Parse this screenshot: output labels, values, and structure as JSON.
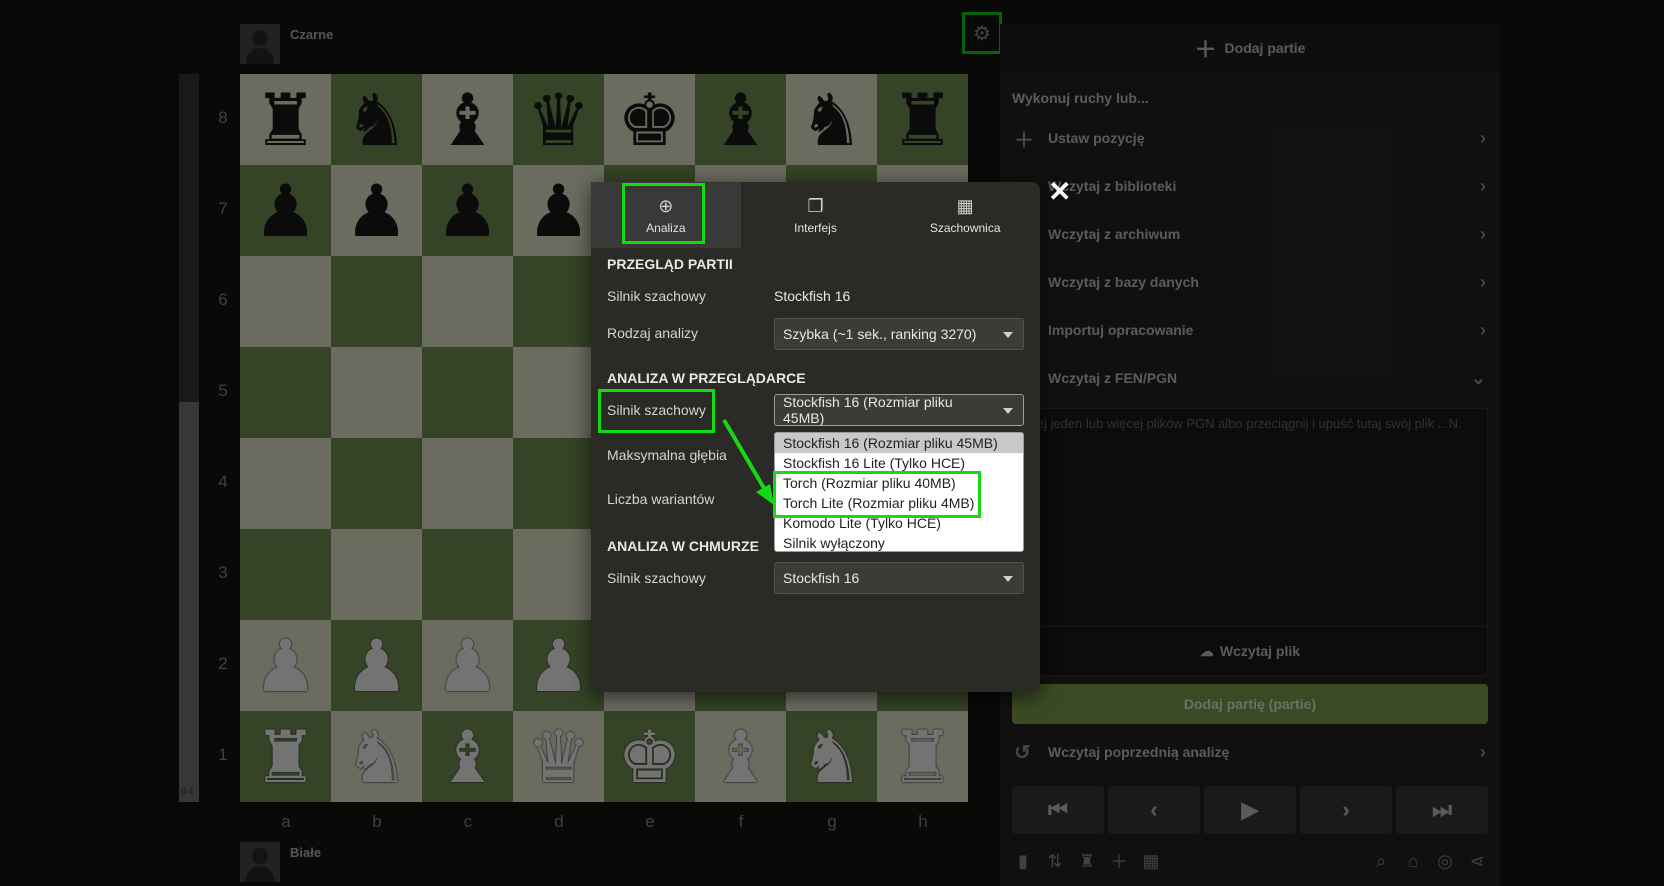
{
  "players": {
    "top_name": "Czarne",
    "bottom_name": "Białe"
  },
  "eval": {
    "label": "0.4",
    "white_fraction": 0.55
  },
  "board": {
    "ranks": [
      "8",
      "7",
      "6",
      "5",
      "4",
      "3",
      "2",
      "1"
    ],
    "files": [
      "a",
      "b",
      "c",
      "d",
      "e",
      "f",
      "g",
      "h"
    ],
    "position": [
      [
        "br",
        "bn",
        "bb",
        "bq",
        "bk",
        "bb",
        "bn",
        "br"
      ],
      [
        "bp",
        "bp",
        "bp",
        "bp",
        "bp",
        "bp",
        "bp",
        "bp"
      ],
      [
        "",
        "",
        "",
        "",
        "",
        "",
        "",
        ""
      ],
      [
        "",
        "",
        "",
        "",
        "",
        "",
        "",
        ""
      ],
      [
        "",
        "",
        "",
        "",
        "",
        "",
        "",
        ""
      ],
      [
        "",
        "",
        "",
        "",
        "",
        "",
        "",
        ""
      ],
      [
        "wp",
        "wp",
        "wp",
        "wp",
        "wp",
        "wp",
        "wp",
        "wp"
      ],
      [
        "wr",
        "wn",
        "wb",
        "wq",
        "wk",
        "wb",
        "wn",
        "wr"
      ]
    ],
    "colors": {
      "light": "#eeeed2",
      "dark": "#769656"
    }
  },
  "right_panel": {
    "add_games_header": "Dodaj partie",
    "subtitle": "Wykonuj ruchy lub...",
    "rows": [
      {
        "icon": "plus-icon",
        "label": "Ustaw pozycję"
      },
      {
        "icon": "library-icon",
        "label": "Wczytaj z biblioteki"
      },
      {
        "icon": "archive-icon",
        "label": "Wczytaj z archiwum"
      },
      {
        "icon": "database-icon",
        "label": "Wczytaj z bazy danych"
      },
      {
        "icon": "import-icon",
        "label": "Importuj opracowanie"
      },
      {
        "icon": "fen-icon",
        "label": "Wczytaj z FEN/PGN"
      }
    ],
    "pgn_placeholder": "...lej jeden lub więcej plików PGN albo przeciągnij i upuść tutaj swój plik ...N.",
    "upload_label": "Wczytaj plik",
    "add_button": "Dodaj partię (partie)",
    "previous_analysis": "Wczytaj poprzednią analizę",
    "accent_color": "#7fa650"
  },
  "settings_modal": {
    "tabs": [
      {
        "label": "Analiza",
        "icon": "analysis-icon",
        "active": true
      },
      {
        "label": "Interfejs",
        "icon": "interface-icon",
        "active": false
      },
      {
        "label": "Szachownica",
        "icon": "board-icon",
        "active": false
      }
    ],
    "review": {
      "title": "PRZEGLĄD PARTII",
      "engine_label": "Silnik szachowy",
      "engine_value": "Stockfish 16",
      "type_label": "Rodzaj analizy",
      "type_value": "Szybka (~1 sek., ranking 3270)"
    },
    "browser": {
      "title": "ANALIZA W PRZEGLĄDARCE",
      "engine_label": "Silnik szachowy",
      "engine_value": "Stockfish 16 (Rozmiar pliku 45MB)",
      "depth_label": "Maksymalna głębia",
      "lines_label": "Liczba wariantów",
      "options": [
        "Stockfish 16 (Rozmiar pliku 45MB)",
        "Stockfish 16 Lite (Tylko HCE)",
        "Torch (Rozmiar pliku 40MB)",
        "Torch Lite (Rozmiar pliku 4MB)",
        "Komodo Lite (Tylko HCE)",
        "Silnik wyłączony"
      ]
    },
    "cloud": {
      "title": "ANALIZA W CHMURZE",
      "engine_label": "Silnik szachowy",
      "engine_value": "Stockfish 16"
    },
    "highlight_color": "#15d915"
  }
}
